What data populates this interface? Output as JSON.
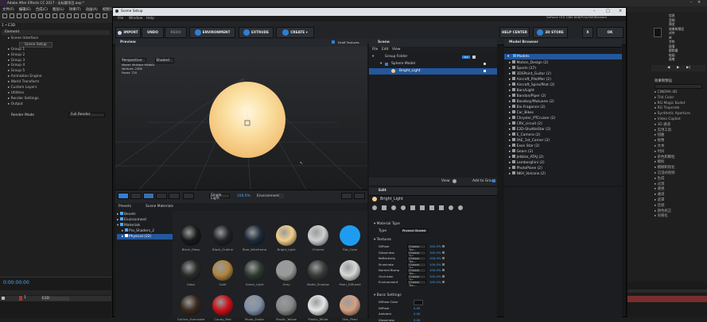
{
  "app": {
    "title": "Adobe After Effects CC 2017 - 无标题项目.aep *",
    "menu": [
      "文件(F)",
      "编辑(E)",
      "合成(C)",
      "图层(L)",
      "效果(T)",
      "动画(A)",
      "视图(V)",
      "窗口",
      "帮助(H)"
    ]
  },
  "left_panel": {
    "header": "1 • E3D",
    "effect": "Element",
    "tree": [
      "Scene Interface",
      "Scene Setup",
      "Group 1",
      "Group 2",
      "Group 3",
      "Group 4",
      "Group 5",
      "Animation Engine",
      "World Transform",
      "Custom Layers",
      "Utilities",
      "Render Settings",
      "Output"
    ],
    "render_mode_label": "Render Mode",
    "render_mode_value": "Full Render",
    "timecode": "0:00:00:00",
    "layer_num": "1",
    "layer_name": "E3D"
  },
  "dialog": {
    "title": "Scene Setup",
    "menu": [
      "File",
      "Window",
      "Help"
    ],
    "gpu": "GeForce GTX 1060 6GB/PCIe/SSE2",
    "gpu_sub": "Element",
    "toolbar": {
      "import": "IMPORT",
      "undo": "UNDO",
      "redo": "REDO",
      "environment": "ENVIRONMENT",
      "extrude": "EXTRUDE",
      "create": "CREATE",
      "help_center": "HELP CENTER",
      "store": "3D STORE",
      "close": "X",
      "ok": "OK"
    },
    "preview": {
      "title": "Preview",
      "draft": "Draft Textures",
      "camera": "Perspective",
      "shading": "Shaded",
      "info": [
        "Model: Multiple Models",
        "Vertices: 2306",
        "Faces: 720"
      ],
      "light_label": "Single Light",
      "light_value": "100.0%",
      "env_label": "Environment"
    },
    "scene": {
      "title": "Scene",
      "menu": [
        "File",
        "Edit",
        "View"
      ],
      "rows": [
        {
          "label": "Group Folder",
          "tag": "G1"
        },
        {
          "label": "Sphere Model",
          "tag": ""
        },
        {
          "label": "Bright_Light",
          "tag": ""
        }
      ],
      "view_label": "View",
      "add_group": "Add to Group"
    },
    "presets": {
      "tab1": "Presets",
      "tab2": "Scene Materials",
      "tree": [
        "Bevels",
        "Environment",
        "Materials",
        "Pro_Shaders_2",
        "Physical (22)"
      ]
    },
    "materials": [
      {
        "name": "Black_Glass",
        "color": "#1a1a1a"
      },
      {
        "name": "Black_Outline",
        "color": "#1f2226"
      },
      {
        "name": "Blue_Wireframe",
        "color": "#1f2a3a"
      },
      {
        "name": "Bright_Light",
        "color": "#f2cf8a"
      },
      {
        "name": "Chrome",
        "color": "#cfcfcf"
      },
      {
        "name": "Flat_Color",
        "color": "#1f9cf0"
      },
      {
        "name": "Glass",
        "color": "#2a2a2a"
      },
      {
        "name": "Gold",
        "color": "#b08440"
      },
      {
        "name": "Green_Light",
        "color": "#2f3a30"
      },
      {
        "name": "Grey",
        "color": "#9a9a9a"
      },
      {
        "name": "Matte_Shadow",
        "color": "#3a3a3a"
      },
      {
        "name": "Pearl_Diffused",
        "color": "#d8d8d8"
      },
      {
        "name": "Outline_Illuminate",
        "color": "#3a2a1e"
      },
      {
        "name": "Candy_Red",
        "color": "#c8111a"
      },
      {
        "name": "Photo_Folder",
        "color": "#8090a8"
      },
      {
        "name": "Plastic_Yellow",
        "color": "#888888"
      },
      {
        "name": "Plastic_White",
        "color": "#e6e6e6"
      },
      {
        "name": "Skin_Pearl",
        "color": "#d4a080"
      }
    ],
    "edit": {
      "title": "Edit",
      "name": "Bright_Light",
      "material_type_label": "Material Type",
      "type_label": "Type",
      "type_value": "Physical Shaded",
      "textures_label": "Textures",
      "textures": [
        {
          "name": "Diffuse",
          "map": "Choose Tex...",
          "value": "100.0%"
        },
        {
          "name": "Glossiness",
          "map": "Choose Tex...",
          "value": "100.0%"
        },
        {
          "name": "Reflectivity",
          "map": "Choose Tex...",
          "value": "100.0%"
        },
        {
          "name": "Illuminate",
          "map": "Choose Tex...",
          "value": "100.0%"
        },
        {
          "name": "Normal Bump",
          "map": "Choose Tex...",
          "value": "100.0%"
        },
        {
          "name": "Occlusion",
          "map": "Choose Tex...",
          "value": "100.0%"
        },
        {
          "name": "Environment",
          "map": "Choose Tex...",
          "value": "100.0%"
        }
      ],
      "basic_label": "Basic Settings",
      "basic": [
        {
          "name": "Diffuse Color",
          "value": ""
        },
        {
          "name": "Diffuse",
          "value": "0.00"
        },
        {
          "name": "Ambient",
          "value": "0.00"
        },
        {
          "name": "Glossiness",
          "value": "0.00"
        }
      ]
    },
    "browser": {
      "title": "Model Browser",
      "root": "Models",
      "items": [
        "Motion_Design (2)",
        "Sports (37)",
        "3DSPoint_Guitar (2)",
        "Aircraft_Pile/Mer (2)",
        "Aircraft_Spiro/Pilot (2)",
        "Bars/Light",
        "Bandan/Piper (2)",
        "Baseboy/Mutuane (2)",
        "Bio Fragance (2)",
        "Car_Bikes",
        "Chrysler_PTCruiser (2)",
        "CRV_circuit (2)",
        "E2D-ShuttleStar (2)",
        "E_Camera (2)",
        "FAE_1st_Corner (2)",
        "Exon Star (2)",
        "Gears (2)",
        "Jetbike_ATAJ (2)",
        "Lamborghini (2)",
        "PhotoPlane (2)",
        "NKH_Volcano (2)"
      ]
    }
  },
  "right_panel": {
    "top_items": [
      "信息",
      "音频",
      "预览",
      "效果和预设",
      "对齐",
      "库",
      "字符",
      "段落",
      "跟踪器",
      "绘画",
      "画笔"
    ],
    "list_title": "效果和预设",
    "list": [
      "CINEMA 4D",
      "Trid Color",
      "RG Magic Bullet",
      "RG Trapcode",
      "Synthetic Aperture",
      "Video Copilot",
      "3D 通道",
      "实用工具",
      "扭曲",
      "抠像",
      "文本",
      "时间",
      "杂色和颗粒",
      "模拟",
      "模糊和锐化",
      "沉浸式视频",
      "生成",
      "过渡",
      "透视",
      "通道",
      "遮罩",
      "音频",
      "颜色校正",
      "风格化"
    ]
  }
}
